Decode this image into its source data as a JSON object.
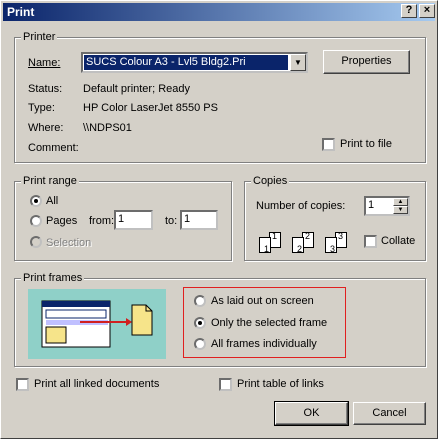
{
  "window": {
    "title": "Print",
    "help_glyph": "?",
    "close_glyph": "×"
  },
  "printer": {
    "group_label": "Printer",
    "name_label": "Name:",
    "name_value": "SUCS Colour A3 - Lvl5 Bldg2.Pri",
    "properties_label": "Properties",
    "status_label": "Status:",
    "status_value": "Default printer; Ready",
    "type_label": "Type:",
    "type_value": "HP Color LaserJet 8550 PS",
    "where_label": "Where:",
    "where_value": "\\\\NDPS01",
    "comment_label": "Comment:",
    "print_to_file_label": "Print to file"
  },
  "print_range": {
    "group_label": "Print range",
    "all_label": "All",
    "pages_label": "Pages",
    "from_label": "from:",
    "from_value": "1",
    "to_label": "to:",
    "to_value": "1",
    "selection_label": "Selection"
  },
  "copies": {
    "group_label": "Copies",
    "number_label": "Number of copies:",
    "number_value": "1",
    "collate_label": "Collate",
    "page_numbers": [
      "1",
      "1",
      "2",
      "2",
      "3",
      "3"
    ]
  },
  "print_frames": {
    "group_label": "Print frames",
    "options": [
      "As laid out on screen",
      "Only the selected frame",
      "All frames individually"
    ],
    "selected_index": 1,
    "highlight_color": "#e02020"
  },
  "footer": {
    "print_linked_label": "Print all linked documents",
    "print_table_links_label": "Print table of links",
    "ok_label": "OK",
    "cancel_label": "Cancel"
  }
}
